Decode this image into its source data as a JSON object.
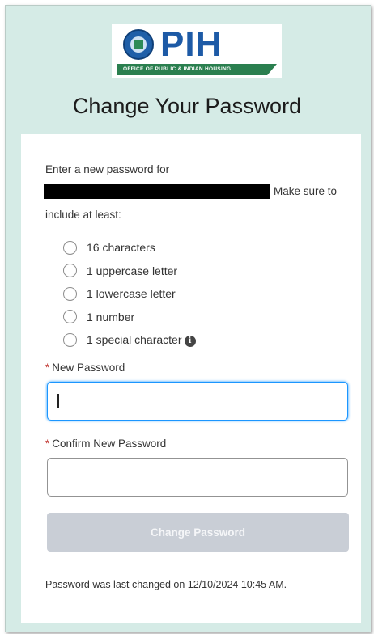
{
  "logo": {
    "wordmark": "PIH",
    "tagline": "OFFICE OF PUBLIC & INDIAN HOUSING"
  },
  "heading": "Change Your Password",
  "instructions": {
    "line1": "Enter a new password for",
    "line2_suffix": "Make sure to",
    "line3": "include at least:"
  },
  "requirements": [
    "16 characters",
    "1 uppercase letter",
    "1 lowercase letter",
    "1 number",
    "1 special character"
  ],
  "fields": {
    "required_marker": "*",
    "new_password_label": "New Password",
    "confirm_password_label": "Confirm New Password",
    "new_password_value": "",
    "confirm_password_value": ""
  },
  "button": {
    "label": "Change Password"
  },
  "footer": {
    "last_changed": "Password was last changed on 12/10/2024 10:45 AM."
  },
  "colors": {
    "background": "#d5ebe6",
    "brand_blue": "#1d5aa6",
    "brand_green": "#2a7f4f",
    "focus_blue": "#1b96ff",
    "required_red": "#c23934",
    "disabled_button": "#c9ced6"
  },
  "icons": {
    "radio": "radio-circle-icon",
    "info": "info-icon"
  }
}
